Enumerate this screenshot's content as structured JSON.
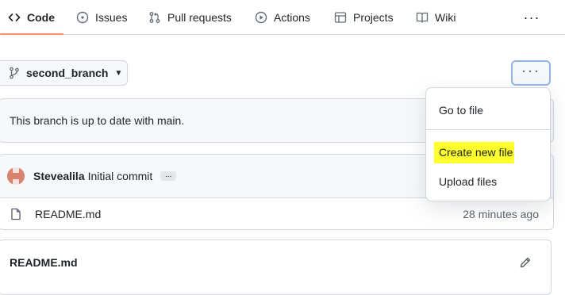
{
  "nav": {
    "tabs": [
      {
        "label": "Code",
        "icon": "code-icon",
        "active": true
      },
      {
        "label": "Issues",
        "icon": "issue-opened-icon"
      },
      {
        "label": "Pull requests",
        "icon": "git-pull-request-icon"
      },
      {
        "label": "Actions",
        "icon": "play-icon"
      },
      {
        "label": "Projects",
        "icon": "table-icon"
      },
      {
        "label": "Wiki",
        "icon": "book-icon"
      }
    ],
    "more_label": "···"
  },
  "branch": {
    "name": "second_branch",
    "icon": "git-branch-icon"
  },
  "kebab": {
    "label": "···"
  },
  "status": {
    "text": "This branch is up to date with main."
  },
  "commit": {
    "author": "Stevealila",
    "message": "Initial commit",
    "more_label": "..."
  },
  "files": [
    {
      "name": "README.md",
      "time": "28 minutes ago",
      "icon": "file-icon"
    }
  ],
  "readme": {
    "title": "README.md",
    "edit_icon": "pencil-icon"
  },
  "menu": {
    "items": [
      {
        "label": "Go to file"
      },
      {
        "label": "Create new file",
        "highlighted": true
      },
      {
        "label": "Upload files"
      }
    ]
  },
  "colors": {
    "active_tab_underline": "#fd8c73",
    "highlight": "#ffff2e",
    "border": "#d0d7de"
  }
}
